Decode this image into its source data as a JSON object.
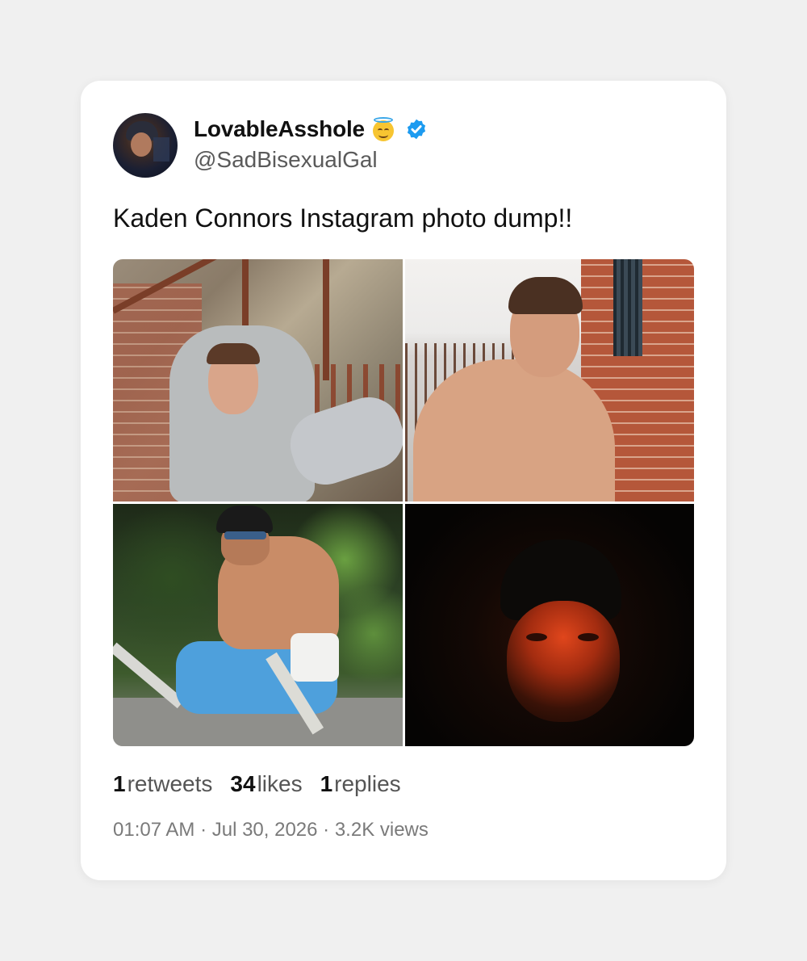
{
  "user": {
    "display_name": "LovableAsshole",
    "emoji": "smiling-face-with-halo",
    "verified": true,
    "handle": "@SadBisexualGal"
  },
  "tweet": {
    "text": "Kaden Connors Instagram photo dump!!",
    "photos": [
      {
        "name": "photo-hoodie-fire-escape"
      },
      {
        "name": "photo-shirtless-brick-wall"
      },
      {
        "name": "photo-outdoor-workout"
      },
      {
        "name": "photo-red-lit-face"
      }
    ]
  },
  "stats": {
    "retweets_count": "1",
    "retweets_label": "retweets",
    "likes_count": "34",
    "likes_label": "likes",
    "replies_count": "1",
    "replies_label": "replies"
  },
  "meta": {
    "line": "01:07 AM · Jul 30, 2026 · 3.2K views"
  },
  "colors": {
    "background": "#f0f0f0",
    "card": "#ffffff",
    "verified_badge": "#1d9bf0",
    "primary_text": "#111111",
    "secondary_text": "#555555",
    "meta_text": "#7a7a7a"
  }
}
